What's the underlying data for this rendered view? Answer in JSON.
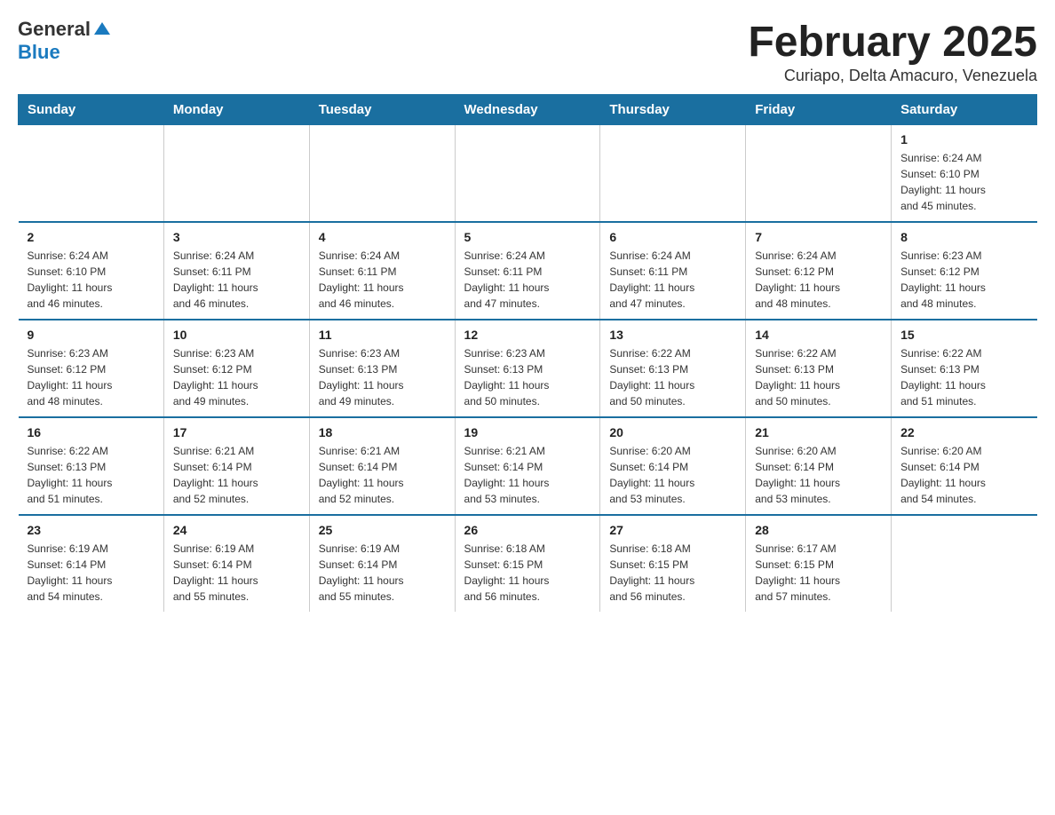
{
  "logo": {
    "general": "General",
    "blue": "Blue"
  },
  "title": "February 2025",
  "subtitle": "Curiapo, Delta Amacuro, Venezuela",
  "days_of_week": [
    "Sunday",
    "Monday",
    "Tuesday",
    "Wednesday",
    "Thursday",
    "Friday",
    "Saturday"
  ],
  "weeks": [
    [
      {
        "day": "",
        "info": ""
      },
      {
        "day": "",
        "info": ""
      },
      {
        "day": "",
        "info": ""
      },
      {
        "day": "",
        "info": ""
      },
      {
        "day": "",
        "info": ""
      },
      {
        "day": "",
        "info": ""
      },
      {
        "day": "1",
        "info": "Sunrise: 6:24 AM\nSunset: 6:10 PM\nDaylight: 11 hours\nand 45 minutes."
      }
    ],
    [
      {
        "day": "2",
        "info": "Sunrise: 6:24 AM\nSunset: 6:10 PM\nDaylight: 11 hours\nand 46 minutes."
      },
      {
        "day": "3",
        "info": "Sunrise: 6:24 AM\nSunset: 6:11 PM\nDaylight: 11 hours\nand 46 minutes."
      },
      {
        "day": "4",
        "info": "Sunrise: 6:24 AM\nSunset: 6:11 PM\nDaylight: 11 hours\nand 46 minutes."
      },
      {
        "day": "5",
        "info": "Sunrise: 6:24 AM\nSunset: 6:11 PM\nDaylight: 11 hours\nand 47 minutes."
      },
      {
        "day": "6",
        "info": "Sunrise: 6:24 AM\nSunset: 6:11 PM\nDaylight: 11 hours\nand 47 minutes."
      },
      {
        "day": "7",
        "info": "Sunrise: 6:24 AM\nSunset: 6:12 PM\nDaylight: 11 hours\nand 48 minutes."
      },
      {
        "day": "8",
        "info": "Sunrise: 6:23 AM\nSunset: 6:12 PM\nDaylight: 11 hours\nand 48 minutes."
      }
    ],
    [
      {
        "day": "9",
        "info": "Sunrise: 6:23 AM\nSunset: 6:12 PM\nDaylight: 11 hours\nand 48 minutes."
      },
      {
        "day": "10",
        "info": "Sunrise: 6:23 AM\nSunset: 6:12 PM\nDaylight: 11 hours\nand 49 minutes."
      },
      {
        "day": "11",
        "info": "Sunrise: 6:23 AM\nSunset: 6:13 PM\nDaylight: 11 hours\nand 49 minutes."
      },
      {
        "day": "12",
        "info": "Sunrise: 6:23 AM\nSunset: 6:13 PM\nDaylight: 11 hours\nand 50 minutes."
      },
      {
        "day": "13",
        "info": "Sunrise: 6:22 AM\nSunset: 6:13 PM\nDaylight: 11 hours\nand 50 minutes."
      },
      {
        "day": "14",
        "info": "Sunrise: 6:22 AM\nSunset: 6:13 PM\nDaylight: 11 hours\nand 50 minutes."
      },
      {
        "day": "15",
        "info": "Sunrise: 6:22 AM\nSunset: 6:13 PM\nDaylight: 11 hours\nand 51 minutes."
      }
    ],
    [
      {
        "day": "16",
        "info": "Sunrise: 6:22 AM\nSunset: 6:13 PM\nDaylight: 11 hours\nand 51 minutes."
      },
      {
        "day": "17",
        "info": "Sunrise: 6:21 AM\nSunset: 6:14 PM\nDaylight: 11 hours\nand 52 minutes."
      },
      {
        "day": "18",
        "info": "Sunrise: 6:21 AM\nSunset: 6:14 PM\nDaylight: 11 hours\nand 52 minutes."
      },
      {
        "day": "19",
        "info": "Sunrise: 6:21 AM\nSunset: 6:14 PM\nDaylight: 11 hours\nand 53 minutes."
      },
      {
        "day": "20",
        "info": "Sunrise: 6:20 AM\nSunset: 6:14 PM\nDaylight: 11 hours\nand 53 minutes."
      },
      {
        "day": "21",
        "info": "Sunrise: 6:20 AM\nSunset: 6:14 PM\nDaylight: 11 hours\nand 53 minutes."
      },
      {
        "day": "22",
        "info": "Sunrise: 6:20 AM\nSunset: 6:14 PM\nDaylight: 11 hours\nand 54 minutes."
      }
    ],
    [
      {
        "day": "23",
        "info": "Sunrise: 6:19 AM\nSunset: 6:14 PM\nDaylight: 11 hours\nand 54 minutes."
      },
      {
        "day": "24",
        "info": "Sunrise: 6:19 AM\nSunset: 6:14 PM\nDaylight: 11 hours\nand 55 minutes."
      },
      {
        "day": "25",
        "info": "Sunrise: 6:19 AM\nSunset: 6:14 PM\nDaylight: 11 hours\nand 55 minutes."
      },
      {
        "day": "26",
        "info": "Sunrise: 6:18 AM\nSunset: 6:15 PM\nDaylight: 11 hours\nand 56 minutes."
      },
      {
        "day": "27",
        "info": "Sunrise: 6:18 AM\nSunset: 6:15 PM\nDaylight: 11 hours\nand 56 minutes."
      },
      {
        "day": "28",
        "info": "Sunrise: 6:17 AM\nSunset: 6:15 PM\nDaylight: 11 hours\nand 57 minutes."
      },
      {
        "day": "",
        "info": ""
      }
    ]
  ]
}
